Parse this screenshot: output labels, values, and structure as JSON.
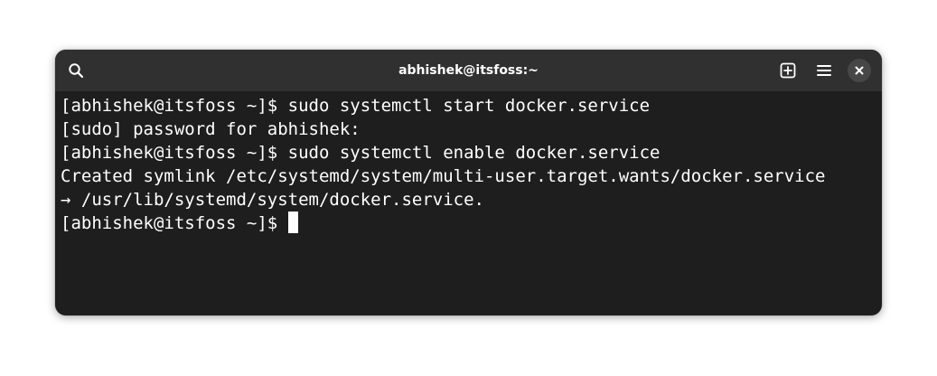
{
  "window": {
    "title": "abhishek@itsfoss:~"
  },
  "titlebar": {
    "search_icon": "search-icon",
    "new_tab_icon": "plus-square-icon",
    "menu_icon": "hamburger-menu-icon",
    "close_icon": "close-icon"
  },
  "terminal": {
    "lines": [
      "[abhishek@itsfoss ~]$ sudo systemctl start docker.service",
      "[sudo] password for abhishek:",
      "[abhishek@itsfoss ~]$ sudo systemctl enable docker.service",
      "Created symlink /etc/systemd/system/multi-user.target.wants/docker.service",
      "→ /usr/lib/systemd/system/docker.service.",
      "[abhishek@itsfoss ~]$ "
    ]
  },
  "colors": {
    "terminal_bg": "#1e1e1e",
    "titlebar_bg": "#303030",
    "foreground": "#ffffff"
  }
}
